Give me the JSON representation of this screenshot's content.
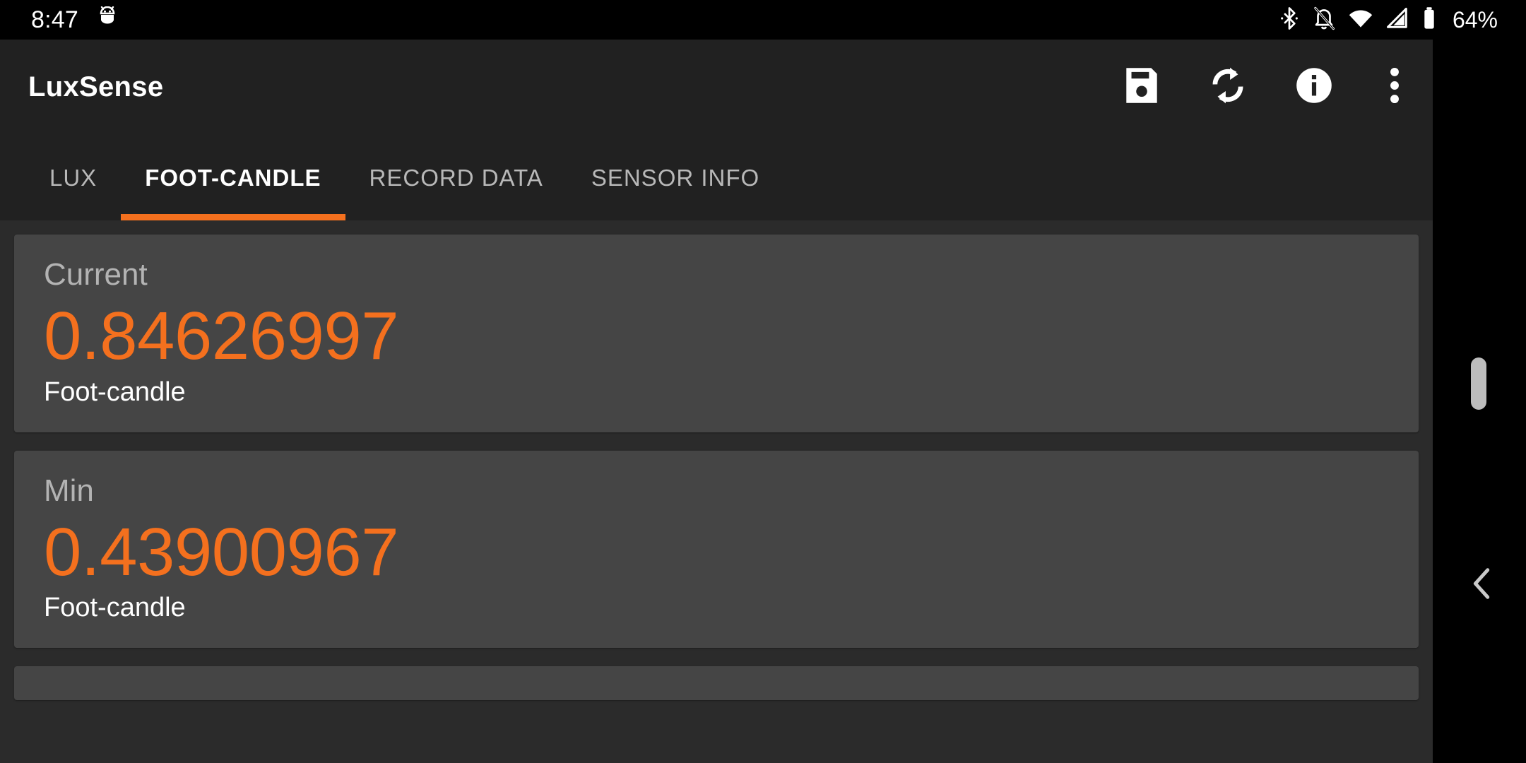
{
  "status_bar": {
    "time": "8:47",
    "battery_percent": "64%",
    "icons": [
      "android-debug-icon",
      "bluetooth-icon",
      "notifications-silenced-icon",
      "wifi-icon",
      "cellular-signal-icon",
      "battery-icon"
    ]
  },
  "toolbar": {
    "app_title": "LuxSense",
    "actions": [
      {
        "name": "save-button",
        "icon": "save-floppy-icon"
      },
      {
        "name": "refresh-button",
        "icon": "refresh-sync-icon"
      },
      {
        "name": "info-button",
        "icon": "info-circle-icon"
      },
      {
        "name": "overflow-menu-button",
        "icon": "more-vertical-icon"
      }
    ]
  },
  "tabs": [
    {
      "label": "LUX",
      "active": false
    },
    {
      "label": "FOOT-CANDLE",
      "active": true
    },
    {
      "label": "RECORD DATA",
      "active": false
    },
    {
      "label": "SENSOR INFO",
      "active": false
    }
  ],
  "cards": [
    {
      "title": "Current",
      "value": "0.84626997",
      "unit": "Foot-candle"
    },
    {
      "title": "Min",
      "value": "0.43900967",
      "unit": "Foot-candle"
    }
  ],
  "colors": {
    "accent_orange": "#f4701e",
    "toolbar_bg": "#212121",
    "page_bg": "#2b2b2b",
    "card_bg": "#454545",
    "title_text": "#b3b3b3",
    "value_text": "#f4701e",
    "unit_text": "#ffffff",
    "tab_inactive": "#b8b8b8",
    "tab_active": "#ffffff"
  },
  "system": {
    "scrollbar": "vertical-scrollbar-thumb",
    "back_gesture": "back-chevron-icon"
  }
}
